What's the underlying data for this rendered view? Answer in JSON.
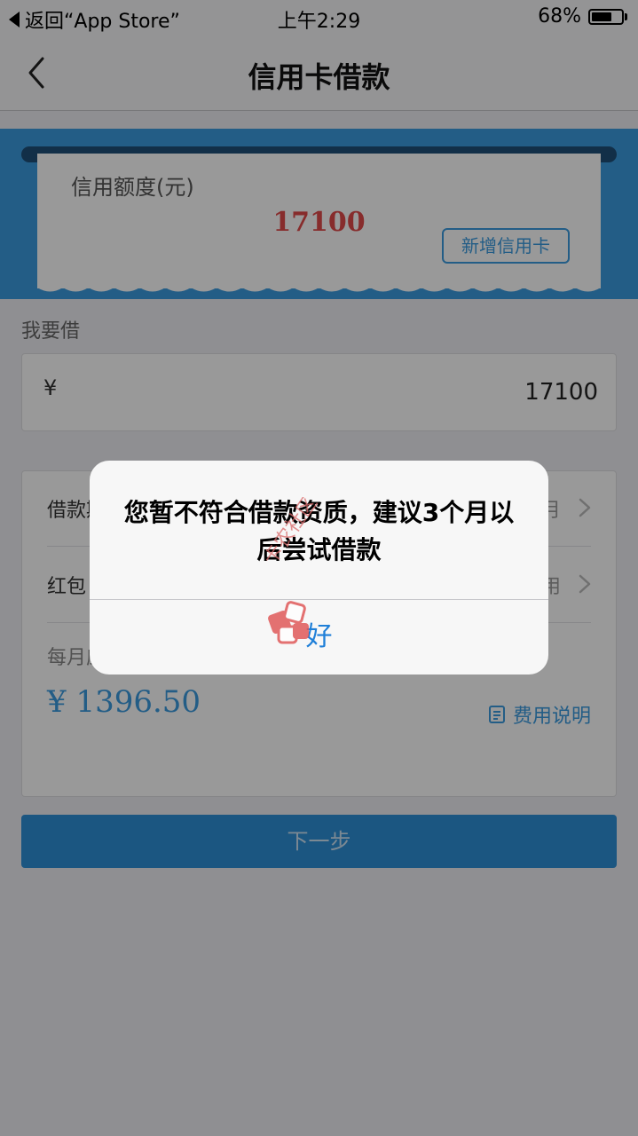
{
  "status_bar": {
    "back_label": "返回“App Store”",
    "time": "上午2:29",
    "battery_text": "68%",
    "battery_level": 0.68
  },
  "nav": {
    "title": "信用卡借款"
  },
  "credit": {
    "label": "信用额度(元)",
    "amount": "17100",
    "add_card_label": "新增信用卡"
  },
  "borrow": {
    "section_label": "我要借",
    "currency_symbol": "¥",
    "amount": "17100"
  },
  "details": {
    "rows": [
      {
        "label": "借款期限",
        "value": "12个月"
      },
      {
        "label": "红包",
        "value": "暂无可用"
      }
    ],
    "monthly_label": "每月应还",
    "monthly_amount": "¥ 1396.50",
    "fee_link_label": "费用说明"
  },
  "next_button_label": "下一步",
  "dialog": {
    "message": "您暂不符合借款资质，建议3个月以后尝试借款",
    "ok_label": "好"
  },
  "colors": {
    "accent_blue": "#3b9be0",
    "amount_red": "#e14a4a",
    "dialog_button": "#1f7fd8"
  },
  "watermark_text": "卡农社区"
}
